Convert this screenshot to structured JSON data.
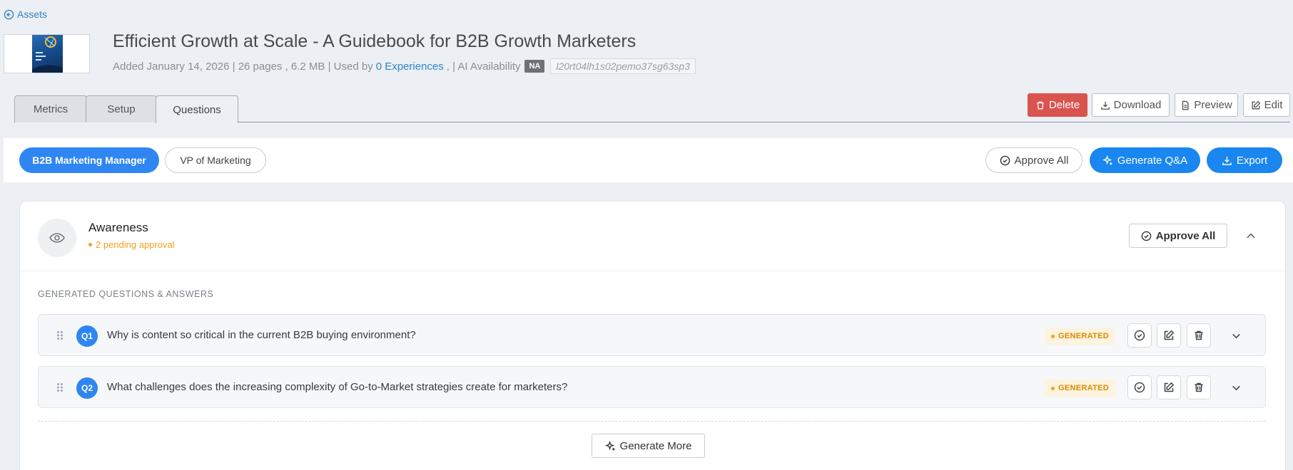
{
  "back_link": {
    "label": "Assets"
  },
  "asset": {
    "title": "Efficient Growth at Scale - A Guidebook for B2B Growth Marketers",
    "meta_prefix": "Added January 14, 2026 | 26 pages , 6.2 MB | Used by",
    "experiences_link": "0 Experiences",
    "meta_suffix": ", | AI Availability",
    "ai_badge": "NA",
    "asset_id": "l20rt04lh1s02pemo37sg63sp3"
  },
  "tabs": [
    {
      "label": "Metrics"
    },
    {
      "label": "Setup"
    },
    {
      "label": "Questions"
    }
  ],
  "header_actions": {
    "delete": "Delete",
    "download": "Download",
    "preview": "Preview",
    "edit": "Edit"
  },
  "personas": [
    {
      "label": "B2B Marketing Manager"
    },
    {
      "label": "VP of Marketing"
    }
  ],
  "persona_actions": {
    "approve_all": "Approve All",
    "generate_qa": "Generate Q&A",
    "export": "Export"
  },
  "stage": {
    "title": "Awareness",
    "pending": "2 pending approval",
    "approve_all": "Approve All",
    "section_label": "GENERATED QUESTIONS & ANSWERS"
  },
  "questions": [
    {
      "num": "Q1",
      "text": "Why is content so critical in the current B2B buying environment?",
      "status": "GENERATED"
    },
    {
      "num": "Q2",
      "text": "What challenges does the increasing complexity of Go-to-Market strategies create for marketers?",
      "status": "GENERATED"
    }
  ],
  "generate_more": "Generate More",
  "colors": {
    "primary": "#2f86f2",
    "danger": "#d9534f",
    "pending": "#f0a020",
    "link": "#2f86c9"
  }
}
